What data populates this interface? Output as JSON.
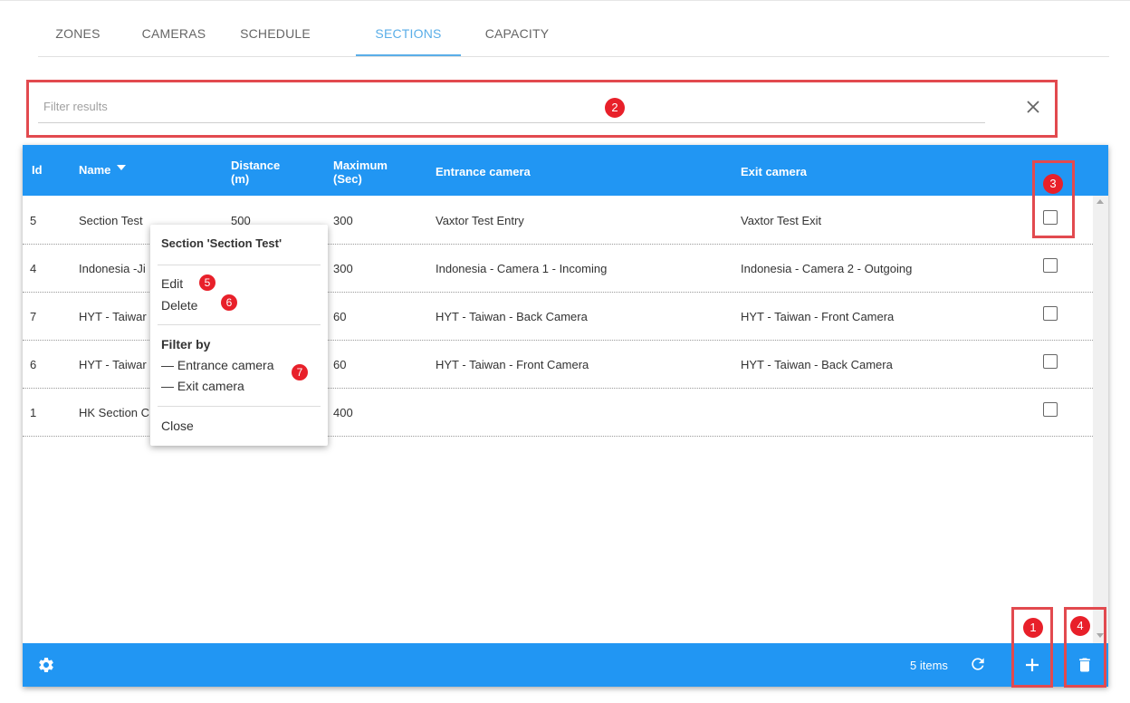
{
  "tabs": [
    {
      "label": "ZONES",
      "active": false
    },
    {
      "label": "CAMERAS",
      "active": false
    },
    {
      "label": "SCHEDULE",
      "active": false
    },
    {
      "label": "SECTIONS",
      "active": true
    },
    {
      "label": "CAPACITY",
      "active": false
    }
  ],
  "filter": {
    "placeholder": "Filter results",
    "value": "",
    "clear_icon": "close-icon"
  },
  "table": {
    "columns": {
      "id": "Id",
      "name": "Name",
      "distance_1": "Distance",
      "distance_2": "(m)",
      "maximum_1": "Maximum",
      "maximum_2": "(Sec)",
      "entrance": "Entrance camera",
      "exit": "Exit camera"
    },
    "sort_icon": "sort-descending-caret-icon",
    "rows": [
      {
        "id": "5",
        "name": "Section Test",
        "distance": "500",
        "maximum": "300",
        "entrance": "Vaxtor Test Entry",
        "exit": "Vaxtor Test Exit"
      },
      {
        "id": "4",
        "name": "Indonesia -Ji",
        "distance": "",
        "maximum": "300",
        "entrance": "Indonesia - Camera 1 - Incoming",
        "exit": "Indonesia - Camera 2 - Outgoing"
      },
      {
        "id": "7",
        "name": "HYT - Taiwar",
        "distance": "",
        "maximum": "60",
        "entrance": "HYT - Taiwan - Back Camera",
        "exit": "HYT - Taiwan - Front Camera"
      },
      {
        "id": "6",
        "name": "HYT - Taiwar",
        "distance": "",
        "maximum": "60",
        "entrance": "HYT - Taiwan - Front Camera",
        "exit": "HYT - Taiwan - Back Camera"
      },
      {
        "id": "1",
        "name": "HK Section C",
        "distance": "",
        "maximum": "400",
        "entrance": "",
        "exit": ""
      }
    ]
  },
  "footer": {
    "count_label": "5 items",
    "settings_icon": "gear-icon",
    "refresh_icon": "refresh-icon",
    "add_icon": "plus-icon",
    "delete_icon": "trash-icon"
  },
  "context_menu": {
    "title": "Section 'Section Test'",
    "edit": "Edit",
    "delete": "Delete",
    "filter_heading": "Filter by",
    "filter_entrance": "— Entrance camera",
    "filter_exit": "— Exit camera",
    "close": "Close"
  },
  "annotations": {
    "badge_1": "1",
    "badge_2": "2",
    "badge_3": "3",
    "badge_4": "4",
    "badge_5": "5",
    "badge_6": "6",
    "badge_7": "7",
    "color": "#e8202a"
  },
  "colors": {
    "accent": "#2196f3",
    "tab_active": "#5aaee8",
    "annotation_border": "#e24a4f"
  }
}
